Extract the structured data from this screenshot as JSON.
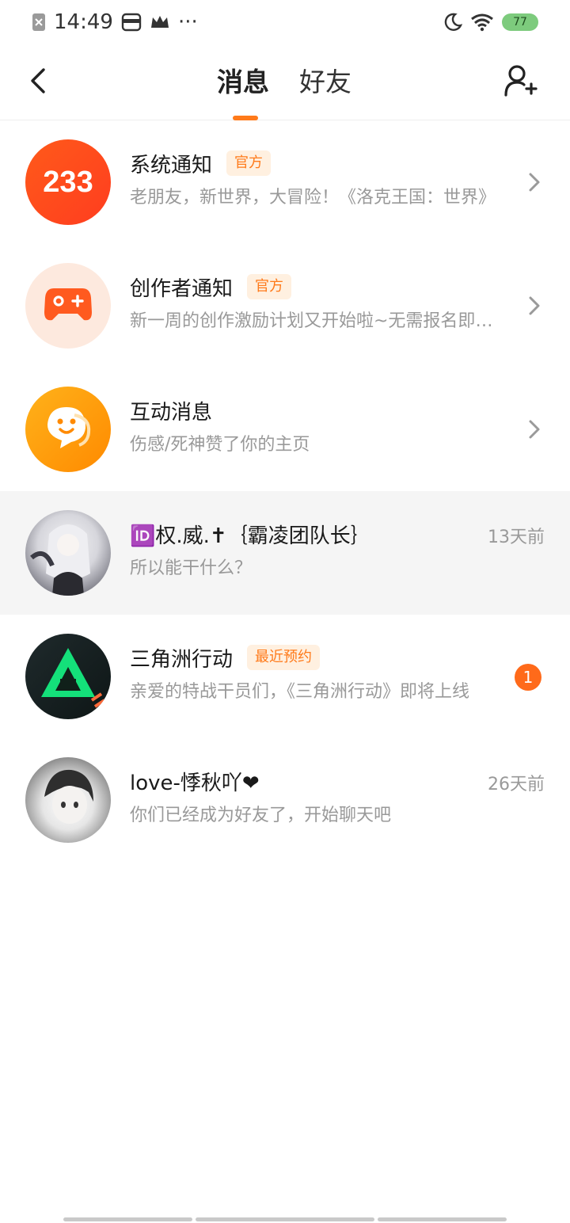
{
  "status_bar": {
    "time": "14:49",
    "more": "···",
    "battery": "77"
  },
  "header": {
    "tabs": [
      {
        "label": "消息",
        "active": true
      },
      {
        "label": "好友",
        "active": false
      }
    ],
    "accent_color": "#ff7a1a"
  },
  "conversations": [
    {
      "title": "系统通知",
      "badge": "官方",
      "subtitle": "老朋友，新世界，大冒险！《洛克王国：世界》",
      "avatar_label": "233",
      "chevron": true
    },
    {
      "title": "创作者通知",
      "badge": "官方",
      "subtitle": "新一周的创作激励计划又开始啦~无需报名即可参与",
      "chevron": true
    },
    {
      "title": "互动消息",
      "subtitle": "伤感/死神赞了你的主页",
      "chevron": true
    },
    {
      "title": "🆔权.威.✝︎｛霸凌团队长｝",
      "subtitle": "所以能干什么？",
      "time": "13天前"
    },
    {
      "title": "三角洲行动",
      "badge": "最近预约",
      "subtitle": "亲爱的特战干员们，《三角洲行动》即将上线",
      "unread": "1"
    },
    {
      "title": "love-悸秋吖❤",
      "subtitle": "你们已经成为好友了，开始聊天吧",
      "time": "26天前"
    }
  ]
}
